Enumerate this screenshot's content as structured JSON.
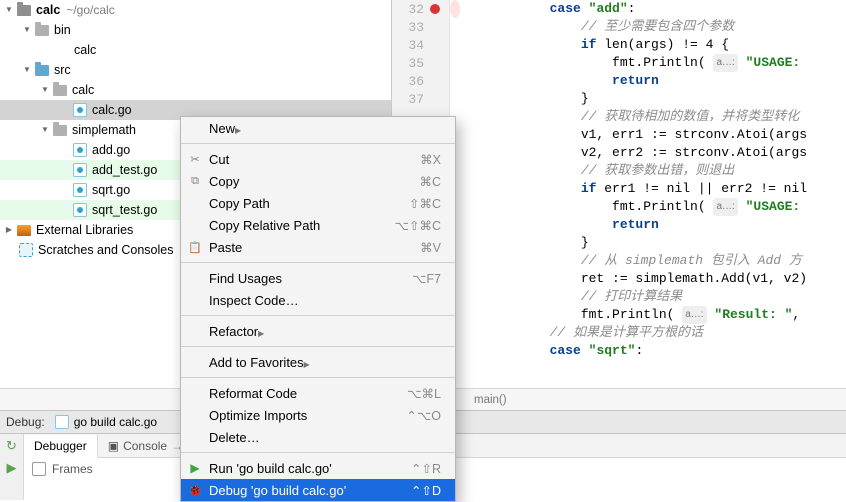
{
  "tree": {
    "root": {
      "name": "calc",
      "path": "~/go/calc"
    },
    "bin": "bin",
    "bin_calc": "calc",
    "src": "src",
    "src_calc": "calc",
    "calc_go": "calc.go",
    "simplemath": "simplemath",
    "add_go": "add.go",
    "add_test_go": "add_test.go",
    "sqrt_go": "sqrt.go",
    "sqrt_test_go": "sqrt_test.go",
    "ext_lib": "External Libraries",
    "scratches": "Scratches and Consoles"
  },
  "gutter": {
    "lines": [
      "32",
      "33",
      "34",
      "35",
      "36",
      "37"
    ],
    "breakpoint_line": "32"
  },
  "code": {
    "l32_kw": "case",
    "l32_str": "\"add\"",
    "l32_tail": ":",
    "l33_cmt": "// 至少需要包含四个参数",
    "l34_a": "if",
    "l34_b": " len(args) != 4 {",
    "l35_a": "fmt.Println( ",
    "l35_hint": "a…:",
    "l35_str": "\"USAGE: ",
    "l36_a": "return",
    "l37_a": "}",
    "l38_cmt": "// 获取待相加的数值，并将类型转化",
    "l39": "v1, err1 := strconv.Atoi(args",
    "l40": "v2, err2 := strconv.Atoi(args",
    "l41_cmt": "// 获取参数出错，则退出",
    "l42_a": "if",
    "l42_b": " err1 != nil || err2 != nil",
    "l43_a": "fmt.Println( ",
    "l43_hint": "a…:",
    "l43_str": "\"USAGE: ",
    "l44_a": "return",
    "l45_a": "}",
    "l46_cmt_a": "// 从 ",
    "l46_cmt_b": "simplemath",
    "l46_cmt_c": " 包引入 ",
    "l46_cmt_d": "Add",
    "l46_cmt_e": " 方",
    "l47": "ret := simplemath.Add(v1, v2)",
    "l48_cmt": "// 打印计算结果",
    "l49_a": "fmt.Println( ",
    "l49_hint": "a…:",
    "l49_str": "\"Result: \"",
    "l49_b": ", ",
    "l50_cmt": "// 如果是计算平方根的话",
    "l51_kw": "case",
    "l51_str": "\"sqrt\"",
    "l51_tail": ":"
  },
  "crumb": "main()",
  "ctx": {
    "new": "New",
    "cut": "Cut",
    "cut_sc": "⌘X",
    "copy": "Copy",
    "copy_sc": "⌘C",
    "copy_path": "Copy Path",
    "copy_path_sc": "⇧⌘C",
    "copy_rel": "Copy Relative Path",
    "copy_rel_sc": "⌥⇧⌘C",
    "paste": "Paste",
    "paste_sc": "⌘V",
    "find_usages": "Find Usages",
    "find_usages_sc": "⌥F7",
    "inspect": "Inspect Code…",
    "refactor": "Refactor",
    "add_fav": "Add to Favorites",
    "reformat": "Reformat Code",
    "reformat_sc": "⌥⌘L",
    "optimize": "Optimize Imports",
    "optimize_sc": "⌃⌥O",
    "delete": "Delete…",
    "run": "Run 'go build calc.go'",
    "run_sc": "⌃⇧R",
    "debug": "Debug 'go build calc.go'",
    "debug_sc": "⌃⇧D"
  },
  "debug": {
    "title": "Debug:",
    "config": "go build calc.go",
    "tab_debugger": "Debugger",
    "tab_console": "Console",
    "frames": "Frames"
  }
}
